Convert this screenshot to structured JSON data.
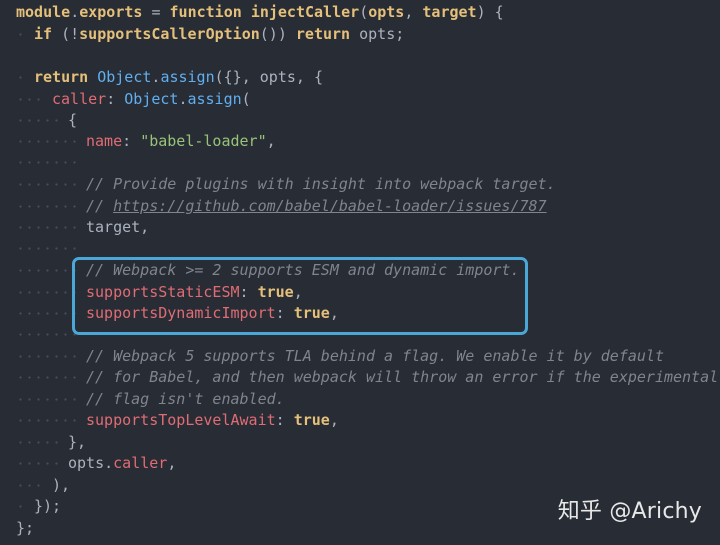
{
  "code": {
    "l1": {
      "a": "module",
      "b": ".",
      "c": "exports",
      "d": " = ",
      "e": "function",
      "f": " ",
      "g": "injectCaller",
      "h": "(",
      "i": "opts",
      "j": ", ",
      "k": "target",
      "l": ") {"
    },
    "l2": {
      "a": "if",
      "b": " (!",
      "c": "supportsCallerOption",
      "d": "()) ",
      "e": "return",
      "f": " opts;"
    },
    "l4": {
      "a": "return",
      "b": " ",
      "c": "Object",
      "d": ".",
      "e": "assign",
      "f": "({}, opts, {"
    },
    "l5": {
      "a": "caller",
      "b": ": ",
      "c": "Object",
      "d": ".",
      "e": "assign",
      "f": "("
    },
    "l6": {
      "a": "{"
    },
    "l7": {
      "a": "name",
      "b": ": ",
      "c": "\"babel-loader\"",
      "d": ","
    },
    "l9": {
      "a": "// Provide plugins with insight into webpack target."
    },
    "l10": {
      "a": "// ",
      "b": "https://github.com/babel/babel-loader/issues/787"
    },
    "l11": {
      "a": "target,"
    },
    "l13": {
      "a": "// Webpack >= 2 supports ESM and dynamic import."
    },
    "l14": {
      "a": "supportsStaticESM",
      "b": ": ",
      "c": "true",
      "d": ","
    },
    "l15": {
      "a": "supportsDynamicImport",
      "b": ": ",
      "c": "true",
      "d": ","
    },
    "l17": {
      "a": "// Webpack 5 supports TLA behind a flag. We enable it by default"
    },
    "l18": {
      "a": "// for Babel, and then webpack will throw an error if the experimental"
    },
    "l19": {
      "a": "// flag isn't enabled."
    },
    "l20": {
      "a": "supportsTopLevelAwait",
      "b": ": ",
      "c": "true",
      "d": ","
    },
    "l21": {
      "a": "},"
    },
    "l22": {
      "a": "opts",
      "b": ".",
      "c": "caller",
      "d": ","
    },
    "l23": {
      "a": "),"
    },
    "l24": {
      "a": "});"
    },
    "l25": {
      "a": "};"
    }
  },
  "watermark": "知乎 @Arichy",
  "colors": {
    "background": "#282c34",
    "highlight_border": "#4aa8d8"
  }
}
